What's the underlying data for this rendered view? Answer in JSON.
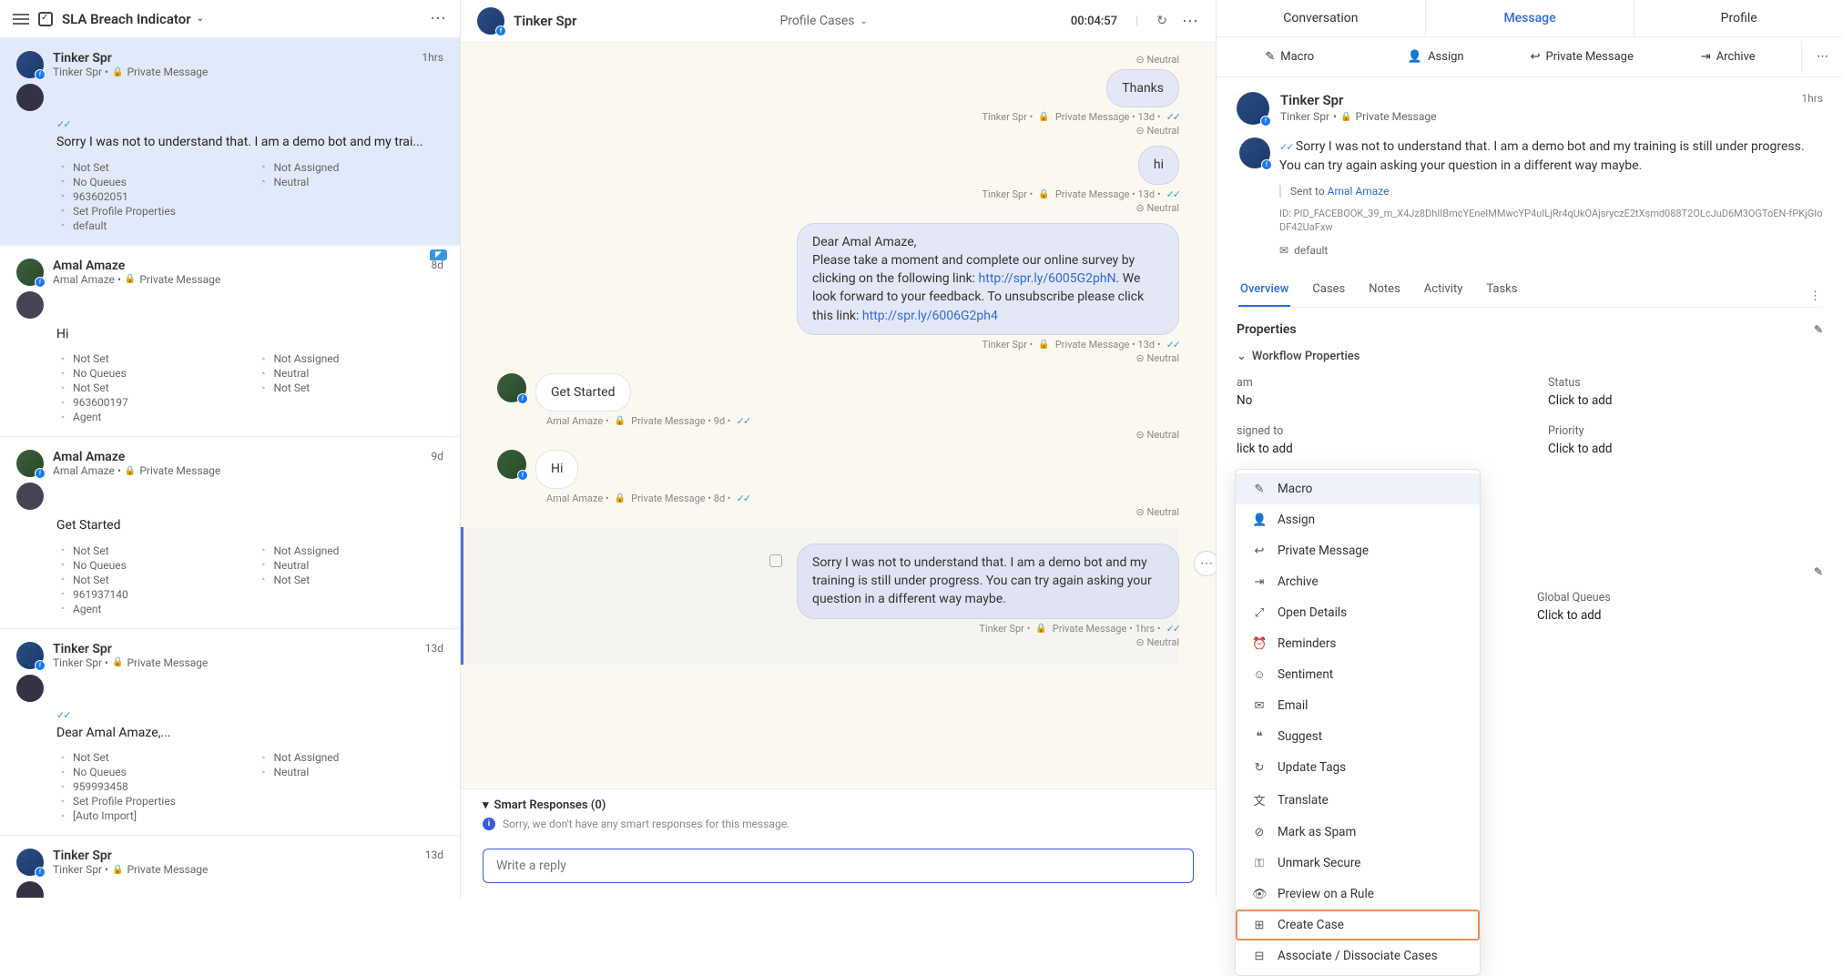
{
  "left": {
    "title": "SLA Breach Indicator",
    "items": [
      {
        "name": "Tinker Spr",
        "sub": "Tinker Spr",
        "channel": "Private Message",
        "time": "1hrs",
        "selected": true,
        "ticks": true,
        "preview": "Sorry I was not to understand that. I am a demo bot and my trai...",
        "meta": [
          [
            "Not Set",
            "Not Assigned"
          ],
          [
            "No Queues",
            "Neutral"
          ],
          [
            "963602051",
            ""
          ],
          [
            "Set Profile Properties",
            ""
          ],
          [
            "default",
            ""
          ]
        ]
      },
      {
        "name": "Amal Amaze",
        "sub": "Amal Amaze",
        "channel": "Private Message",
        "time": "8d",
        "arrow": true,
        "preview": "Hi",
        "meta": [
          [
            "Not Set",
            "Not Assigned"
          ],
          [
            "No Queues",
            "Neutral"
          ],
          [
            "Not Set",
            "Not Set"
          ],
          [
            "963600197",
            ""
          ],
          [
            "Agent",
            ""
          ]
        ]
      },
      {
        "name": "Amal Amaze",
        "sub": "Amal Amaze",
        "channel": "Private Message",
        "time": "9d",
        "preview": "Get Started",
        "meta": [
          [
            "Not Set",
            "Not Assigned"
          ],
          [
            "No Queues",
            "Neutral"
          ],
          [
            "Not Set",
            "Not Set"
          ],
          [
            "961937140",
            ""
          ],
          [
            "Agent",
            ""
          ]
        ]
      },
      {
        "name": "Tinker Spr",
        "sub": "Tinker Spr",
        "channel": "Private Message",
        "time": "13d",
        "ticks": true,
        "preview": "Dear Amal Amaze,...",
        "meta": [
          [
            "Not Set",
            "Not Assigned"
          ],
          [
            "No Queues",
            "Neutral"
          ],
          [
            "959993458",
            ""
          ],
          [
            "Set Profile Properties",
            ""
          ],
          [
            "[Auto Import]",
            ""
          ]
        ]
      },
      {
        "name": "Tinker Spr",
        "sub": "Tinker Spr",
        "channel": "Private Message",
        "time": "13d"
      }
    ]
  },
  "center": {
    "title": "Tinker Spr",
    "middle": "Profile Cases",
    "timer": "00:04:57",
    "messages": [
      {
        "dir": "out",
        "text": "Thanks",
        "meta": "Tinker Spr",
        "channel": "Private Message",
        "age": "13d",
        "sent": "Neutral",
        "topSent": "Neutral"
      },
      {
        "dir": "out",
        "text": "hi",
        "meta": "Tinker Spr",
        "channel": "Private Message",
        "age": "13d",
        "sent": "Neutral"
      },
      {
        "dir": "out",
        "html": true,
        "lines": [
          "Dear Amal Amaze,",
          "Please take a moment and complete our online survey by clicking on the following link:"
        ],
        "link1": "http://spr.ly/6005G2phN",
        "mid": ". We look forward to your feedback.  To unsubscribe please click this link:",
        "link2": "http://spr.ly/6006G2ph4",
        "meta": "Tinker Spr",
        "channel": "Private Message",
        "age": "13d",
        "sent": "Neutral"
      },
      {
        "dir": "in",
        "text": "Get Started",
        "meta": "Amal Amaze",
        "channel": "Private Message",
        "age": "9d",
        "sent": "Neutral"
      },
      {
        "dir": "in",
        "text": "Hi",
        "meta": "Amal Amaze",
        "channel": "Private Message",
        "age": "8d",
        "sent": "Neutral"
      },
      {
        "dir": "out",
        "last": true,
        "text": "Sorry I was not to understand that. I am a demo bot and my training is still under progress. You can try again asking your question in a different way maybe.",
        "meta": "Tinker Spr",
        "channel": "Private Message",
        "age": "1hrs",
        "sent": "Neutral"
      }
    ],
    "smart_hd": "Smart Responses (0)",
    "smart_body": "Sorry, we don't have any smart responses for this message.",
    "reply_ph": "Write a reply"
  },
  "right": {
    "topTabs": [
      "Conversation",
      "Message",
      "Profile"
    ],
    "topActive": 1,
    "actions": [
      "Macro",
      "Assign",
      "Private Message",
      "Archive"
    ],
    "name": "Tinker Spr",
    "sub": "Tinker Spr",
    "channel": "Private Message",
    "time": "1hrs",
    "msg": "Sorry I was not to understand that. I am a demo bot and my training is still under progress. You can try again asking your question in a different way maybe.",
    "sent_prefix": "Sent to ",
    "sent_to": "Amal Amaze",
    "id_label": "ID: ",
    "id": "PID_FACEBOOK_39_m_X4Jz8DhIIBmcYEneIMMwcYP4uILjRr4qUkOAjsryczE2tXsmd088T2OLcJuD6M3OGToEN-fPKjGIoDF42UaFxw",
    "default": "default",
    "subtabs": [
      "Overview",
      "Cases",
      "Notes",
      "Activity",
      "Tasks"
    ],
    "subActive": 0,
    "props_title": "Properties",
    "wf_title": "Workflow Properties",
    "grid": [
      {
        "lbl": "am",
        "val": "No"
      },
      {
        "lbl": "Status",
        "val": "Click to add"
      },
      {
        "lbl": "signed to",
        "val": "lick to add"
      },
      {
        "lbl": "Priority",
        "val": "Click to add"
      }
    ],
    "lower": [
      {
        "lbl": "Global Queues",
        "val": "Click to add"
      }
    ],
    "ctx": [
      {
        "ico": "✎",
        "label": "Macro",
        "hov": true
      },
      {
        "ico": "👤",
        "label": "Assign"
      },
      {
        "ico": "↩",
        "label": "Private Message"
      },
      {
        "ico": "⇥",
        "label": "Archive"
      },
      {
        "ico": "⤢",
        "label": "Open Details"
      },
      {
        "ico": "⏰",
        "label": "Reminders"
      },
      {
        "ico": "☺",
        "label": "Sentiment"
      },
      {
        "ico": "✉",
        "label": "Email"
      },
      {
        "ico": "❝",
        "label": "Suggest"
      },
      {
        "ico": "↻",
        "label": "Update Tags"
      },
      {
        "ico": "文",
        "label": "Translate"
      },
      {
        "ico": "⊘",
        "label": "Mark as Spam"
      },
      {
        "ico": "⚿",
        "label": "Unmark Secure"
      },
      {
        "ico": "👁",
        "label": "Preview on a Rule"
      },
      {
        "ico": "⊞",
        "label": "Create Case",
        "hl": true
      },
      {
        "ico": "⊟",
        "label": "Associate / Dissociate Cases"
      }
    ]
  }
}
